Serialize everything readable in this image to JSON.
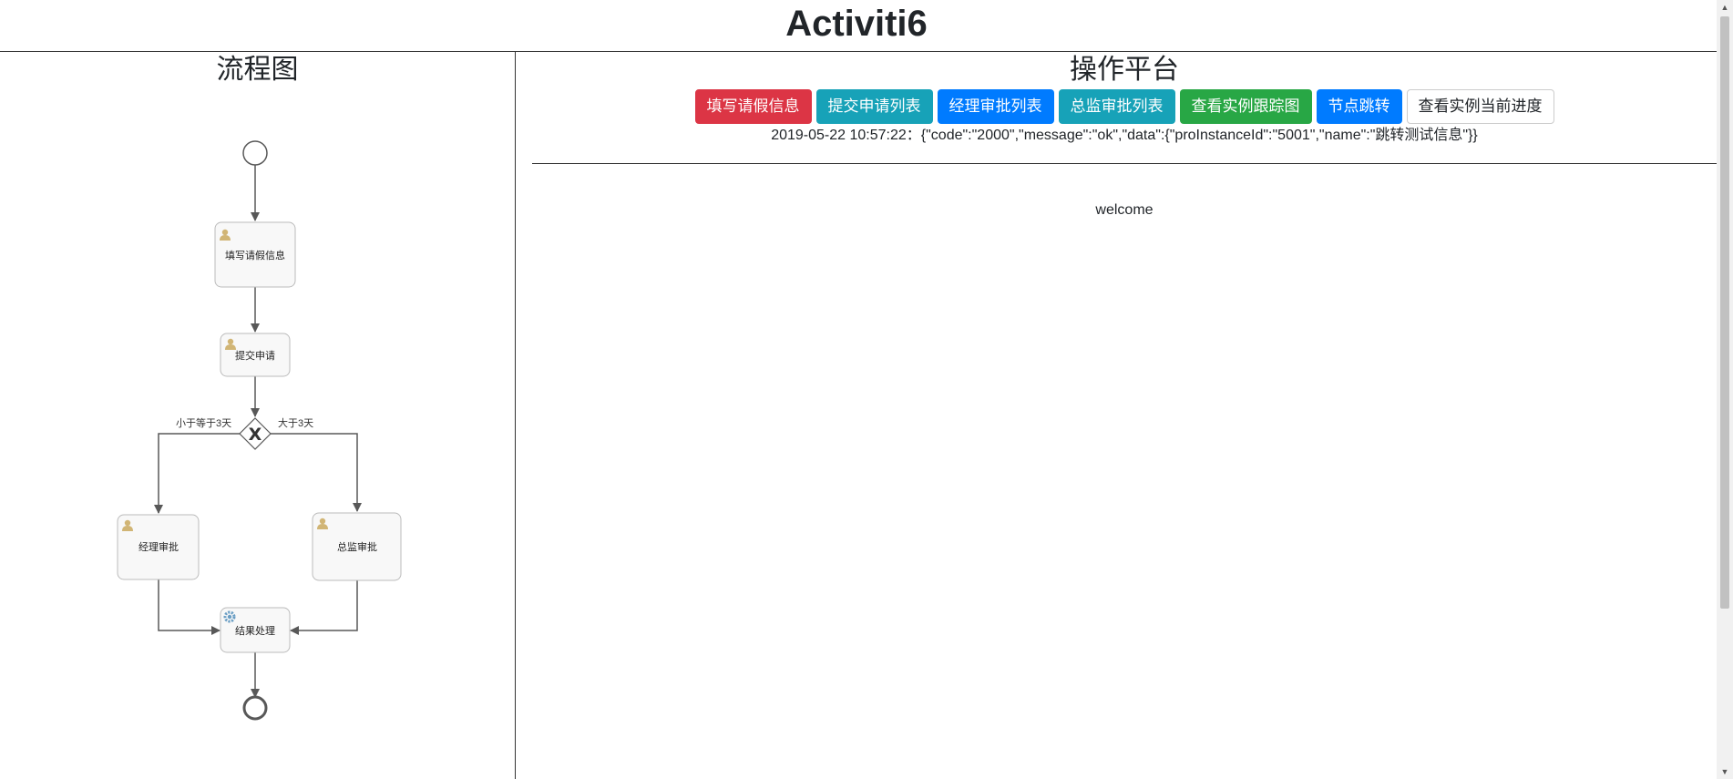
{
  "app": {
    "title": "Activiti6"
  },
  "left": {
    "title": "流程图",
    "diagram": {
      "tasks": {
        "fill_leave": "填写请假信息",
        "submit": "提交申请",
        "manager": "经理审批",
        "director": "总监审批",
        "result": "结果处理"
      },
      "flows": {
        "le3": "小于等于3天",
        "gt3": "大于3天"
      },
      "gateway_symbol": "X"
    }
  },
  "right": {
    "title": "操作平台",
    "buttons": [
      {
        "label": "填写请假信息",
        "color": "#dc3545"
      },
      {
        "label": "提交申请列表",
        "color": "#17a2b8"
      },
      {
        "label": "经理审批列表",
        "color": "#007bff"
      },
      {
        "label": "总监审批列表",
        "color": "#17a2b8"
      },
      {
        "label": "查看实例跟踪图",
        "color": "#28a745"
      },
      {
        "label": "节点跳转",
        "color": "#007bff"
      },
      {
        "label": "查看实例当前进度",
        "color": "#ffffff"
      }
    ],
    "status": "2019-05-22 10:57:22：{\"code\":\"2000\",\"message\":\"ok\",\"data\":{\"proInstanceId\":\"5001\",\"name\":\"跳转测试信息\"}}",
    "welcome": "welcome"
  }
}
